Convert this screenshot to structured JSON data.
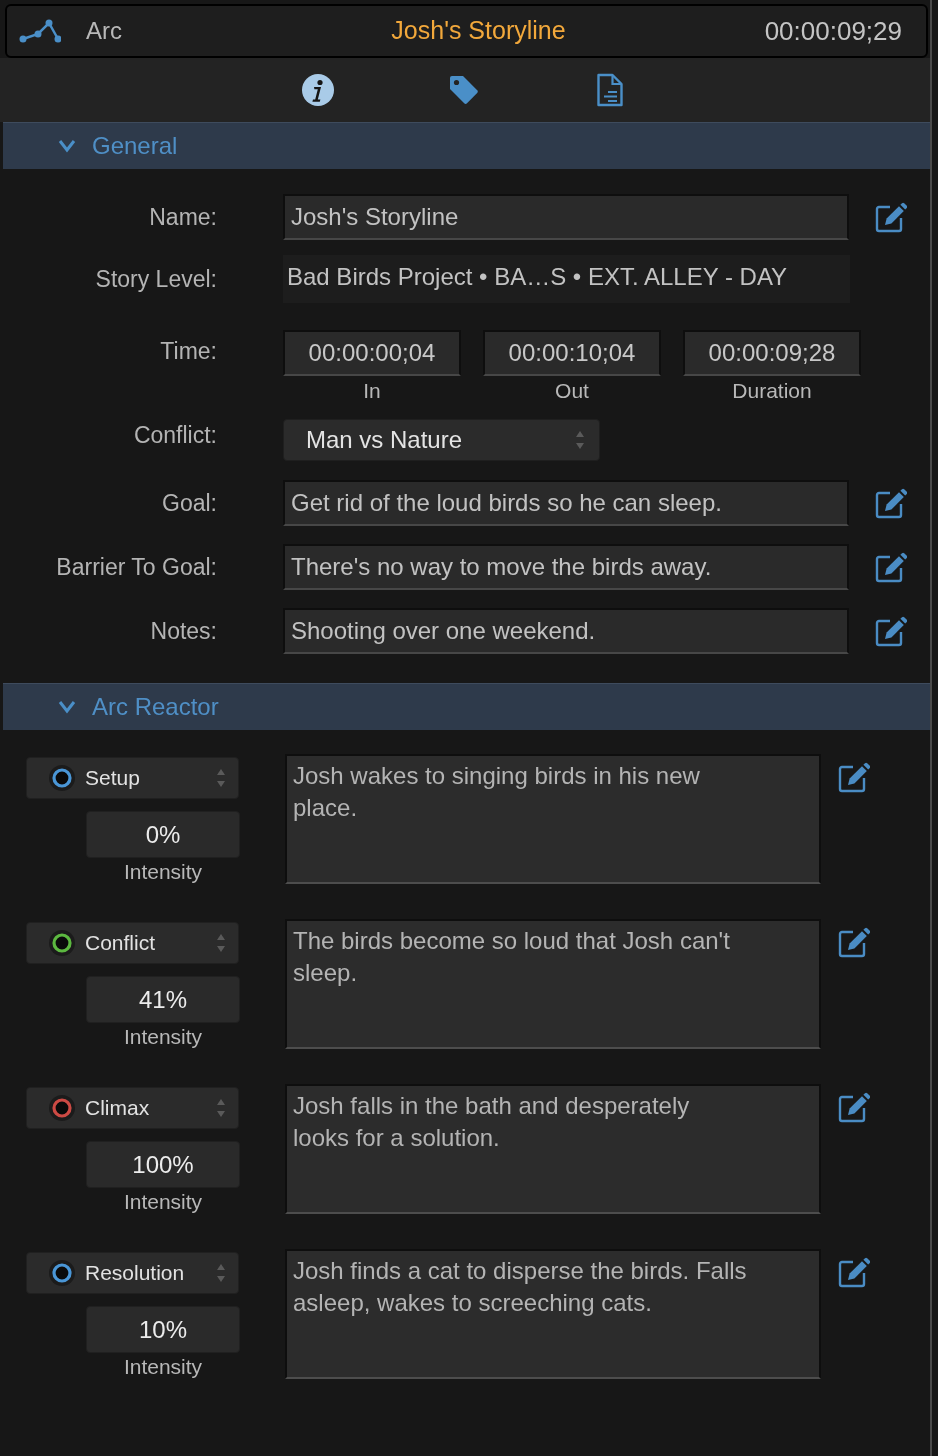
{
  "header": {
    "title": "Arc",
    "storyline": "Josh's Storyline",
    "timecode": "00:00:09;29"
  },
  "tabs": [
    {
      "kind": "info",
      "selected": true
    },
    {
      "kind": "tag",
      "selected": false
    },
    {
      "kind": "document",
      "selected": false
    }
  ],
  "general": {
    "title": "General",
    "expanded": true,
    "fields": [
      {
        "kind": "text",
        "label": "Name:",
        "value": "Josh's Storyline"
      },
      {
        "kind": "path",
        "label": "Story Level:",
        "value": "Bad Birds Project • BA…S • EXT. ALLEY - DAY"
      },
      {
        "kind": "time",
        "label": "Time:",
        "parts": [
          {
            "value": "00:00:00;04",
            "caption": "In"
          },
          {
            "value": "00:00:10;04",
            "caption": "Out"
          },
          {
            "value": "00:00:09;28",
            "caption": "Duration"
          }
        ]
      },
      {
        "kind": "select",
        "label": "Conflict:",
        "value": "Man vs Nature"
      },
      {
        "kind": "text",
        "label": "Goal:",
        "value": "Get rid of the loud birds so he can sleep."
      },
      {
        "kind": "text",
        "label": "Barrier To Goal:",
        "value": "There's no way to move the birds away."
      },
      {
        "kind": "text",
        "label": "Notes:",
        "value": "Shooting over one weekend."
      }
    ]
  },
  "arc_reactor": {
    "title": "Arc Reactor",
    "expanded": true,
    "beats": [
      {
        "stage": "Setup",
        "color": "#4a96d6",
        "intensity": "0%",
        "intensity_label": "Intensity",
        "description": "Josh wakes to singing birds in his new place."
      },
      {
        "stage": "Conflict",
        "color": "#5cb840",
        "intensity": "41%",
        "intensity_label": "Intensity",
        "description": "The birds become so loud that Josh can't sleep."
      },
      {
        "stage": "Climax",
        "color": "#cc4a44",
        "intensity": "100%",
        "intensity_label": "Intensity",
        "description": "Josh falls in the bath and desperately looks for a solution."
      },
      {
        "stage": "Resolution",
        "color": "#4a96d6",
        "intensity": "10%",
        "intensity_label": "Intensity",
        "description": "Josh finds a cat to disperse the birds. Falls asleep, wakes to screeching cats."
      }
    ]
  }
}
